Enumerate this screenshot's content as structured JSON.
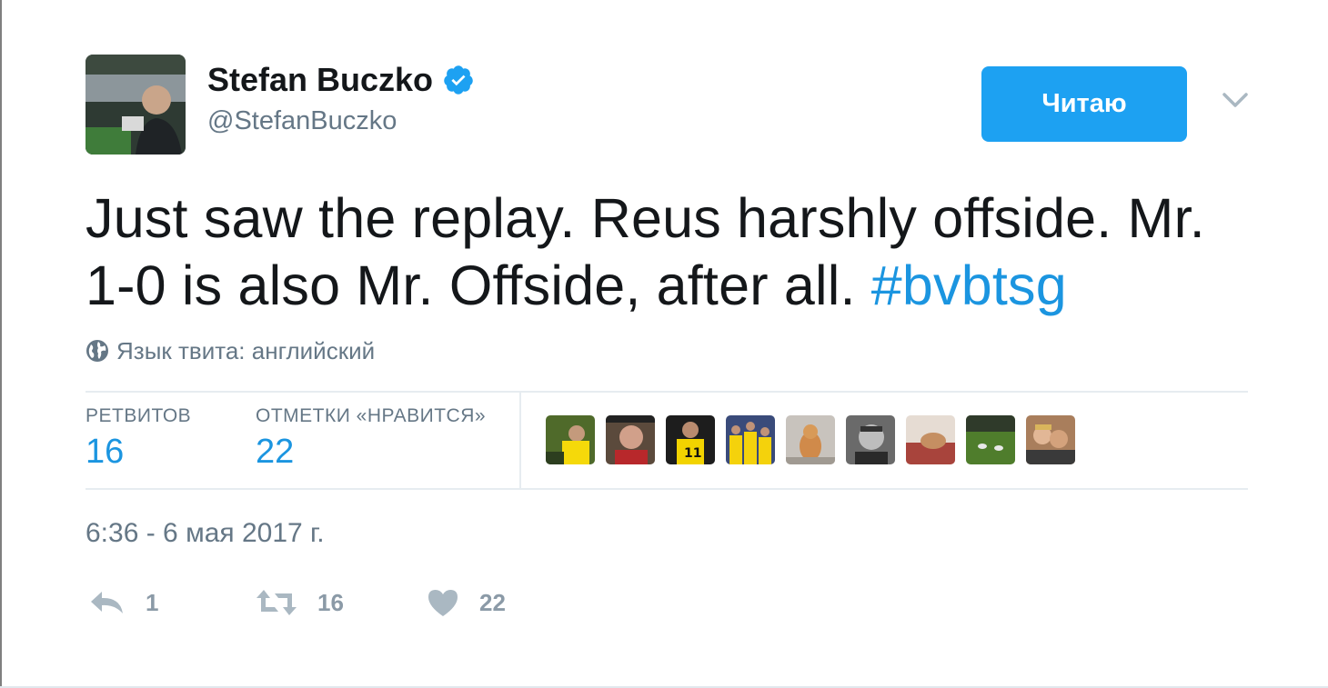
{
  "tweet": {
    "author": {
      "display_name": "Stefan Buczko",
      "handle": "@StefanBuczko",
      "verified": true
    },
    "follow_button_label": "Читаю",
    "text_main": "Just saw the replay. Reus harshly offside. Mr. 1-0 is also Mr. Offside, after all. ",
    "hashtag": "#bvbtsg",
    "language_label": "Язык твита: английский",
    "stats": {
      "retweets_label": "РЕТВИТОВ",
      "retweets_count": "16",
      "likes_label": "ОТМЕТКИ «НРАВИТСЯ»",
      "likes_count": "22"
    },
    "timestamp": "6:36 - 6 мая 2017 г.",
    "actions": {
      "reply_count": "1",
      "retweet_count": "16",
      "like_count": "22"
    }
  },
  "colors": {
    "accent": "#1da1f2",
    "link": "#1b95e0",
    "muted": "#657786",
    "text": "#14171a"
  },
  "icons": [
    "verified-badge-icon",
    "chevron-down-icon",
    "globe-icon",
    "reply-icon",
    "retweet-icon",
    "heart-icon"
  ]
}
